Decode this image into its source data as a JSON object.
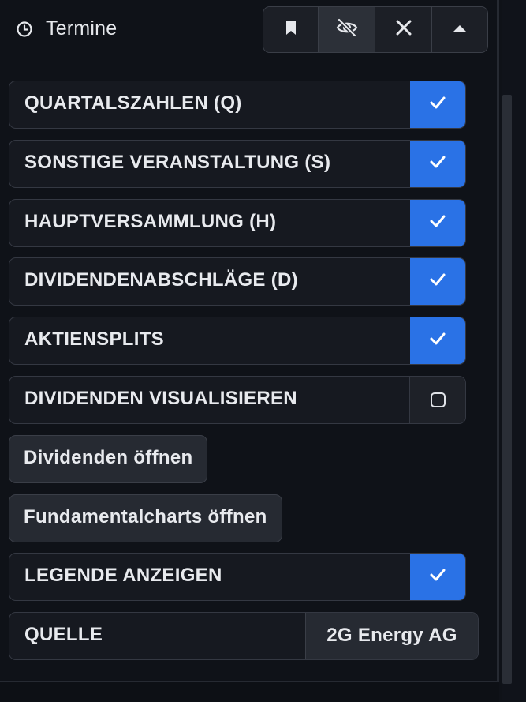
{
  "header": {
    "title": "Termine",
    "icon": "clock-icon",
    "toolbar": [
      "bookmark-icon",
      "eye-off-icon",
      "close-icon",
      "chevron-up-icon"
    ]
  },
  "toggles": [
    {
      "label": "QUARTALSZAHLEN (Q)",
      "checked": true
    },
    {
      "label": "SONSTIGE VERANSTALTUNG (S)",
      "checked": true
    },
    {
      "label": "HAUPTVERSAMMLUNG (H)",
      "checked": true
    },
    {
      "label": "DIVIDENDENABSCHLÄGE (D)",
      "checked": true
    },
    {
      "label": "AKTIENSPLITS",
      "checked": true
    },
    {
      "label": "DIVIDENDEN VISUALISIEREN",
      "checked": false
    }
  ],
  "buttons": {
    "dividends": "Dividenden öffnen",
    "fundamentals": "Fundamentalcharts öffnen"
  },
  "legend": {
    "label": "LEGENDE ANZEIGEN",
    "checked": true
  },
  "source": {
    "label": "QUELLE",
    "value": "2G Energy AG"
  },
  "colors": {
    "accent": "#2a72e6",
    "background": "#0f1218"
  }
}
